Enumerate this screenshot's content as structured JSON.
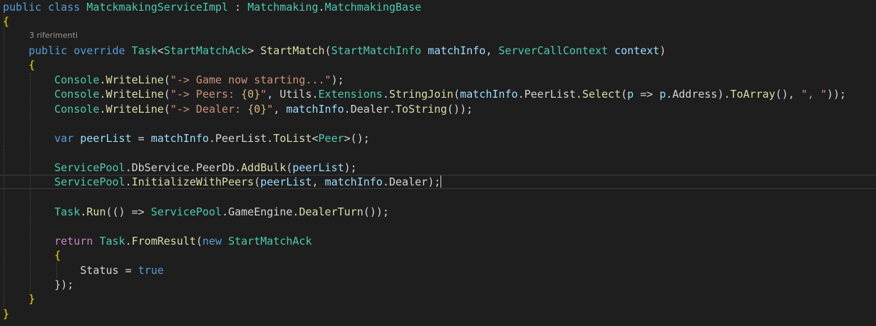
{
  "editor": {
    "codelens": "3 riferimenti",
    "lines": [
      [
        [
          "kw",
          "public "
        ],
        [
          "kw",
          "class "
        ],
        [
          "ty",
          "MatckmakingServiceImpl"
        ],
        [
          "txt",
          " : "
        ],
        [
          "ty",
          "Matchmaking"
        ],
        [
          "txt",
          "."
        ],
        [
          "ty",
          "MatchmakingBase"
        ]
      ],
      [
        [
          "brace",
          "{"
        ]
      ],
      [
        [
          "txt",
          "    "
        ],
        [
          "kw",
          "public "
        ],
        [
          "kw",
          "override "
        ],
        [
          "ty",
          "Task"
        ],
        [
          "txt",
          "<"
        ],
        [
          "ty",
          "StartMatchAck"
        ],
        [
          "txt",
          "> "
        ],
        [
          "fn",
          "StartMatch"
        ],
        [
          "txt",
          "("
        ],
        [
          "ty",
          "StartMatchInfo "
        ],
        [
          "prm",
          "matchInfo"
        ],
        [
          "txt",
          ", "
        ],
        [
          "ty",
          "ServerCallContext "
        ],
        [
          "prm",
          "context"
        ],
        [
          "txt",
          ")"
        ]
      ],
      [
        [
          "txt",
          "    "
        ],
        [
          "brace",
          "{"
        ]
      ],
      [
        [
          "txt",
          "        "
        ],
        [
          "ty",
          "Console"
        ],
        [
          "txt",
          "."
        ],
        [
          "fn",
          "WriteLine"
        ],
        [
          "txt",
          "("
        ],
        [
          "str",
          "\"-> Game now starting...\""
        ],
        [
          "txt",
          ");"
        ]
      ],
      [
        [
          "txt",
          "        "
        ],
        [
          "ty",
          "Console"
        ],
        [
          "txt",
          "."
        ],
        [
          "fn",
          "WriteLine"
        ],
        [
          "txt",
          "("
        ],
        [
          "str",
          "\"-> Peers: "
        ],
        [
          "esc",
          "{0}"
        ],
        [
          "str",
          "\""
        ],
        [
          "txt",
          ", "
        ],
        [
          "txt",
          "Utils"
        ],
        [
          "txt",
          "."
        ],
        [
          "ty",
          "Extensions"
        ],
        [
          "txt",
          "."
        ],
        [
          "fn",
          "StringJoin"
        ],
        [
          "txt",
          "("
        ],
        [
          "prm",
          "matchInfo"
        ],
        [
          "txt",
          "."
        ],
        [
          "txt",
          "PeerList"
        ],
        [
          "txt",
          "."
        ],
        [
          "fn",
          "Select"
        ],
        [
          "txt",
          "("
        ],
        [
          "prm",
          "p"
        ],
        [
          "txt",
          " => "
        ],
        [
          "prm",
          "p"
        ],
        [
          "txt",
          "."
        ],
        [
          "txt",
          "Address"
        ],
        [
          "txt",
          ")."
        ],
        [
          "fn",
          "ToArray"
        ],
        [
          "txt",
          "(), "
        ],
        [
          "str",
          "\", \""
        ],
        [
          "txt",
          "));"
        ]
      ],
      [
        [
          "txt",
          "        "
        ],
        [
          "ty",
          "Console"
        ],
        [
          "txt",
          "."
        ],
        [
          "fn",
          "WriteLine"
        ],
        [
          "txt",
          "("
        ],
        [
          "str",
          "\"-> Dealer: "
        ],
        [
          "esc",
          "{0}"
        ],
        [
          "str",
          "\""
        ],
        [
          "txt",
          ", "
        ],
        [
          "prm",
          "matchInfo"
        ],
        [
          "txt",
          "."
        ],
        [
          "txt",
          "Dealer"
        ],
        [
          "txt",
          "."
        ],
        [
          "fn",
          "ToString"
        ],
        [
          "txt",
          "());"
        ]
      ],
      [],
      [
        [
          "txt",
          "        "
        ],
        [
          "kw",
          "var "
        ],
        [
          "var",
          "peerList"
        ],
        [
          "txt",
          " = "
        ],
        [
          "prm",
          "matchInfo"
        ],
        [
          "txt",
          "."
        ],
        [
          "txt",
          "PeerList"
        ],
        [
          "txt",
          "."
        ],
        [
          "fn",
          "ToList"
        ],
        [
          "txt",
          "<"
        ],
        [
          "ty",
          "Peer"
        ],
        [
          "txt",
          ">();"
        ]
      ],
      [],
      [
        [
          "txt",
          "        "
        ],
        [
          "ty",
          "ServicePool"
        ],
        [
          "txt",
          "."
        ],
        [
          "txt",
          "DbService"
        ],
        [
          "txt",
          "."
        ],
        [
          "txt",
          "PeerDb"
        ],
        [
          "txt",
          "."
        ],
        [
          "fn",
          "AddBulk"
        ],
        [
          "txt",
          "("
        ],
        [
          "var",
          "peerList"
        ],
        [
          "txt",
          ");"
        ]
      ],
      [
        [
          "txt",
          "        "
        ],
        [
          "ty",
          "ServicePool"
        ],
        [
          "txt",
          "."
        ],
        [
          "fn",
          "InitializeWithPeers"
        ],
        [
          "txt",
          "("
        ],
        [
          "var",
          "peerList"
        ],
        [
          "txt",
          ", "
        ],
        [
          "prm",
          "matchInfo"
        ],
        [
          "txt",
          "."
        ],
        [
          "txt",
          "Dealer"
        ],
        [
          "txt",
          ");"
        ]
      ],
      [],
      [
        [
          "txt",
          "        "
        ],
        [
          "ty",
          "Task"
        ],
        [
          "txt",
          "."
        ],
        [
          "fn",
          "Run"
        ],
        [
          "txt",
          "(() => "
        ],
        [
          "ty",
          "ServicePool"
        ],
        [
          "txt",
          "."
        ],
        [
          "txt",
          "GameEngine"
        ],
        [
          "txt",
          "."
        ],
        [
          "fn",
          "DealerTurn"
        ],
        [
          "txt",
          "());"
        ]
      ],
      [],
      [
        [
          "txt",
          "        "
        ],
        [
          "ctrl",
          "return "
        ],
        [
          "ty",
          "Task"
        ],
        [
          "txt",
          "."
        ],
        [
          "fn",
          "FromResult"
        ],
        [
          "txt",
          "("
        ],
        [
          "kw",
          "new "
        ],
        [
          "ty",
          "StartMatchAck"
        ]
      ],
      [
        [
          "txt",
          "        "
        ],
        [
          "brace",
          "{"
        ]
      ],
      [
        [
          "txt",
          "            "
        ],
        [
          "txt",
          "Status"
        ],
        [
          "txt",
          " = "
        ],
        [
          "kw",
          "true"
        ]
      ],
      [
        [
          "txt",
          "        "
        ],
        [
          "txt",
          "});"
        ]
      ],
      [
        [
          "txt",
          "    "
        ],
        [
          "brace",
          "}"
        ]
      ],
      [
        [
          "brace",
          "}"
        ]
      ]
    ]
  }
}
